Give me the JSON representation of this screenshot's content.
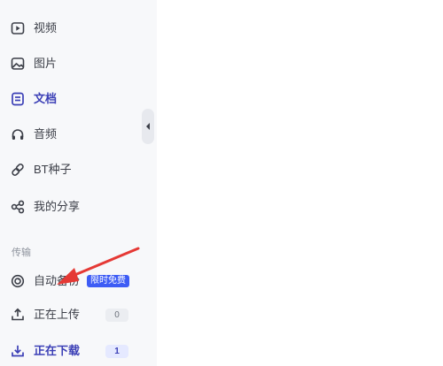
{
  "sidebar": {
    "items": [
      {
        "label": "视频",
        "icon": "video-icon"
      },
      {
        "label": "图片",
        "icon": "image-icon"
      },
      {
        "label": "文档",
        "icon": "document-icon"
      },
      {
        "label": "音频",
        "icon": "headphones-icon"
      },
      {
        "label": "BT种子",
        "icon": "link-icon"
      },
      {
        "label": "我的分享",
        "icon": "share-icon"
      }
    ],
    "active_item": "文档",
    "section_title": "传输",
    "transfer": [
      {
        "label": "自动备份",
        "icon": "backup-icon",
        "badge": "限时免费"
      },
      {
        "label": "正在上传",
        "icon": "upload-icon",
        "count": "0"
      },
      {
        "label": "正在下载",
        "icon": "download-icon",
        "count": "1"
      }
    ]
  },
  "colors": {
    "accent": "#3b3fb6",
    "promo_badge": "#3d5cf5",
    "annotation_arrow": "#e53935",
    "sidebar_bg": "#f7f8fa"
  }
}
